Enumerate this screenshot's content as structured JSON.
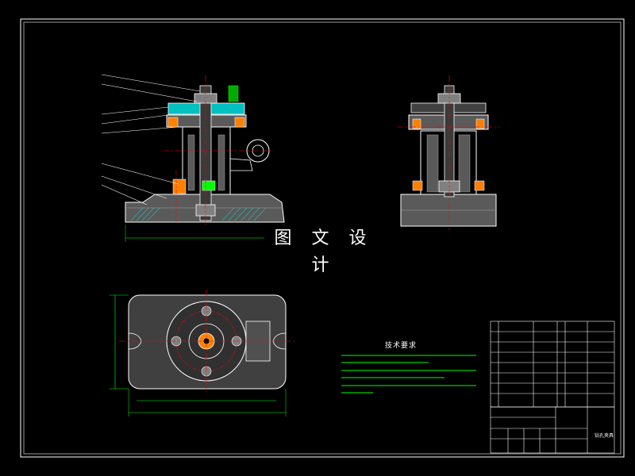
{
  "watermark": "图 文 设 计",
  "tech_requirements_title": "技术要求",
  "title_block": {
    "drawing_name": "钻孔夹具"
  },
  "colors": {
    "background": "#000000",
    "outline": "#ffffff",
    "centerline": "#ff0000",
    "dimension": "#00ff00",
    "hatch": "#00ffff",
    "part_fill": "#ff8000",
    "wall": "#a0a0a0",
    "text_green": "#00ff00",
    "yellow": "#ffff00"
  },
  "icons": [
    "drawing-frame",
    "front-section-view",
    "side-section-view",
    "top-view",
    "bom-table"
  ]
}
